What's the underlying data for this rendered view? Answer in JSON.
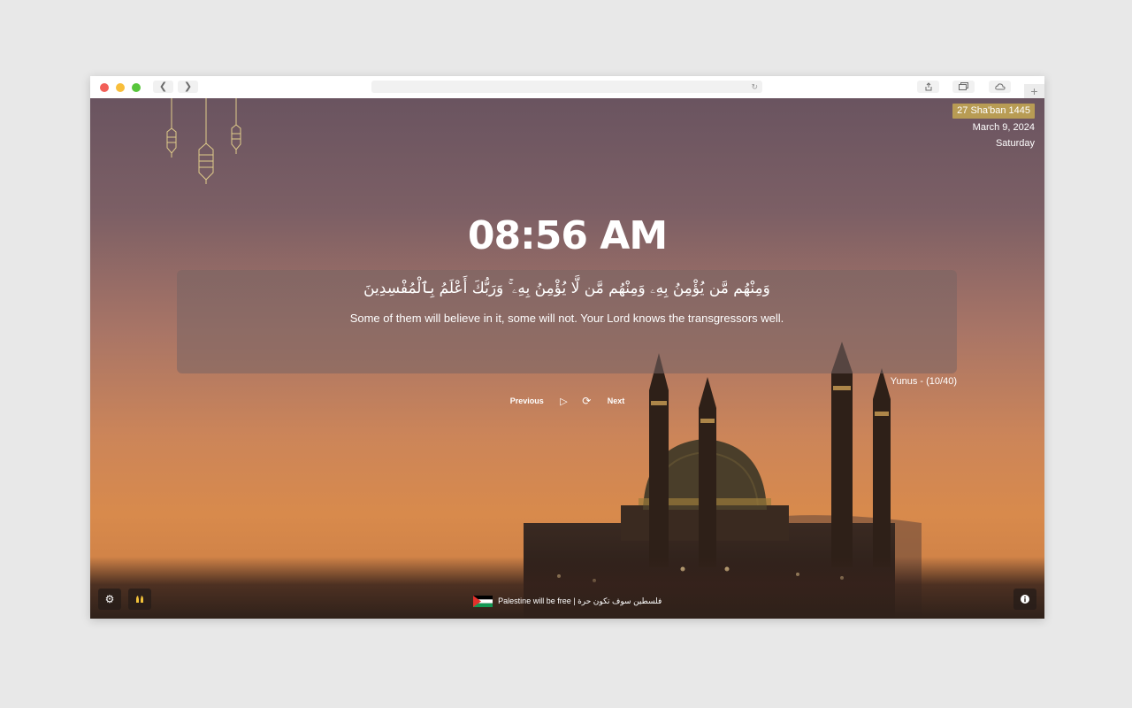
{
  "browser": {
    "back_icon": "chevron-left",
    "forward_icon": "chevron-right",
    "reload_icon": "reload",
    "new_tab_label": "+"
  },
  "date": {
    "hijri": "27 Sha'ban 1445",
    "gregorian": "March 9, 2024",
    "weekday": "Saturday"
  },
  "clock": "08:56 AM",
  "verse": {
    "arabic": "وَمِنْهُم مَّن يُؤْمِنُ بِهِۦ وَمِنْهُم مَّن لَّا يُؤْمِنُ بِهِۦ ۚ وَرَبُّكَ أَعْلَمُ بِٱلْمُفْسِدِينَ",
    "translation": "Some of them will believe in it, some will not. Your Lord knows the transgressors well.",
    "reference": "Yunus - (10/40)"
  },
  "controls": {
    "previous": "Previous",
    "next": "Next",
    "play_icon": "▷",
    "repeat_icon": "⟳"
  },
  "footer": {
    "message": "Palestine will be free | فلسطين سوف تكون حرة"
  },
  "colors": {
    "hijri_badge": "#b89c54",
    "lantern": "#e0cc8a"
  }
}
